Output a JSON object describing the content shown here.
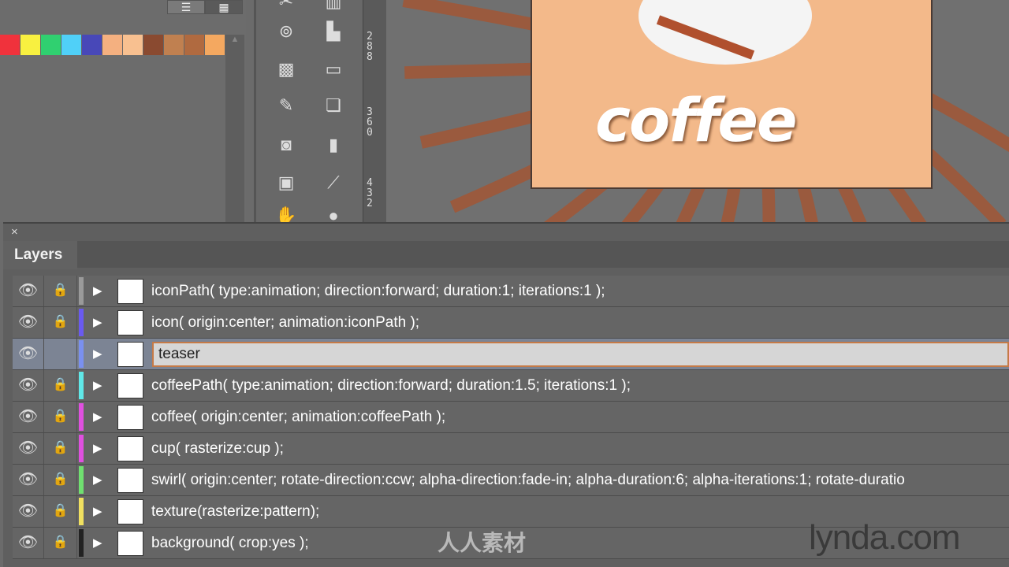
{
  "swatches": [
    "#f0323c",
    "#f8f040",
    "#30d070",
    "#50d0f8",
    "#4848b8",
    "#f4b080",
    "#f8c090",
    "#8a4a30",
    "#c08050",
    "#b06a40",
    "#f4a860"
  ],
  "ruler": [
    "288",
    "360",
    "432"
  ],
  "canvas": {
    "headline": "coffee"
  },
  "panel": {
    "close": "×",
    "tab": "Layers"
  },
  "layers": [
    {
      "name": "iconPath( type:animation; direction:forward; duration:1; iterations:1 );",
      "color": "#9a9a9a",
      "locked": true
    },
    {
      "name": "icon( origin:center; animation:iconPath );",
      "color": "#6a5af0",
      "locked": true
    },
    {
      "name": "teaser",
      "color": "#7a90f0",
      "locked": false,
      "editing": true
    },
    {
      "name": "coffeePath( type:animation; direction:forward; duration:1.5; iterations:1 );",
      "color": "#60e8e8",
      "locked": true
    },
    {
      "name": "coffee( origin:center; animation:coffeePath );",
      "color": "#e050e0",
      "locked": true
    },
    {
      "name": "cup( rasterize:cup );",
      "color": "#e050e0",
      "locked": true
    },
    {
      "name": "swirl( origin:center; rotate-direction:ccw; alpha-direction:fade-in; alpha-duration:6; alpha-iterations:1; rotate-duratio",
      "color": "#70e070",
      "locked": true
    },
    {
      "name": "texture(rasterize:pattern);",
      "color": "#f0e060",
      "locked": true
    },
    {
      "name": "background( crop:yes );",
      "color": "#222222",
      "locked": true
    }
  ],
  "watermark": {
    "logo": "lynda.com",
    "site": "人人素材"
  }
}
